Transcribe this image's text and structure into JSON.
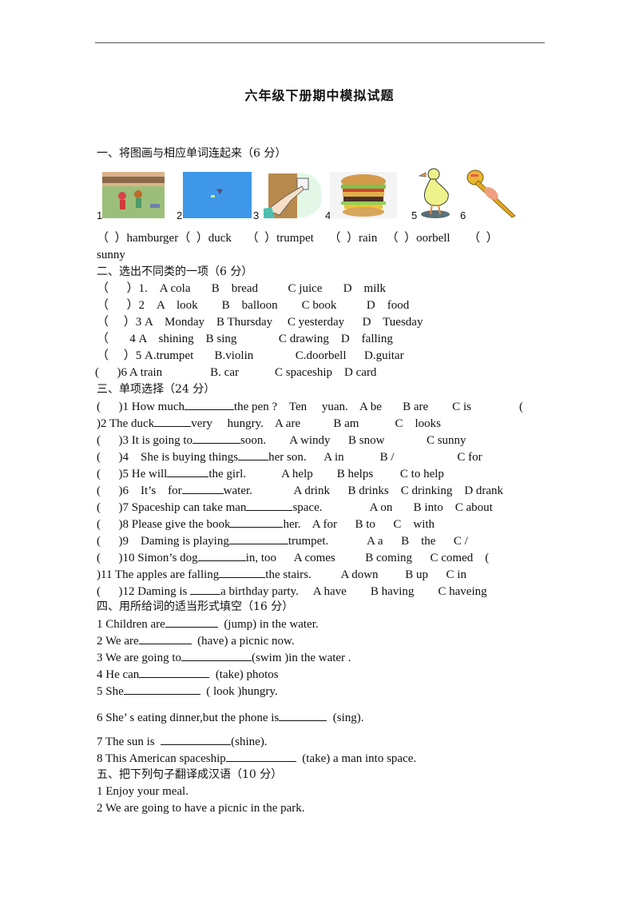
{
  "title": "六年级下册期中模拟试题",
  "sections": {
    "s1": {
      "heading": "一、将图画与相应单词连起来（6 分）",
      "pictures": [
        {
          "num": "1",
          "icon": "children-painting-image"
        },
        {
          "num": "2",
          "icon": "kite-sky-image"
        },
        {
          "num": "3",
          "icon": "doorbell-finger-image"
        },
        {
          "num": "4",
          "icon": "hamburger-image"
        },
        {
          "num": "5",
          "icon": "duck-image"
        },
        {
          "num": "6",
          "icon": "trumpet-image"
        }
      ],
      "words_line": "（  ）hamburger（  ）duck     （  ）trumpet     （  ）rain   （  ）oorbell      （  ）",
      "words_line2": "sunny"
    },
    "s2": {
      "heading": "二、选出不同类的一项（6 分）",
      "items": [
        "（      ）1.    A cola       B    bread          C juice       D    milk",
        "（      ）2    A    look        B    balloon        C book          D    food",
        "（     ）3 A    Monday    B Thursday     C yesterday      D    Tuesday",
        "（       4 A    shining    B sing              C drawing    D    falling",
        "（     ）5 A.trumpet       B.violin              C.doorbell      D.guitar",
        "(      )6 A train                B. car            C spaceship    D card"
      ]
    },
    "s3": {
      "heading": "三、单项选择（24 分）",
      "items": [
        {
          "pre": "(      )1 How much",
          "blank": 62,
          "post": "the pen ?    Ten     yuan.    A be       B are        C is                ("
        },
        {
          "pre": ")2 The duck",
          "blank": 46,
          "post": "very     hungry.    A are           B am            C    looks"
        },
        {
          "pre": "(      )3 It is going to",
          "blank": 60,
          "post": "soon.        A windy      B snow              C sunny"
        },
        {
          "pre": "(      )4    She is buying things",
          "blank": 38,
          "post": "her son.      A in            B /                     C for"
        },
        {
          "pre": "(      )5 He will",
          "blank": 52,
          "post": "the girl.            A help        B helps         C to help"
        },
        {
          "pre": "(      )6    It’s    for",
          "blank": 52,
          "post": "water.              A drink      B drinks    C drinking    D drank"
        },
        {
          "pre": "(      )7 Spaceship can take man",
          "blank": 58,
          "post": "space.                A on       B into    C about"
        },
        {
          "pre": "(      )8 Please give the book",
          "blank": 66,
          "post": "her.    A for      B to      C    with"
        },
        {
          "pre": "(      )9    Daming is playing",
          "blank": 74,
          "post": "trumpet.             A a      B    the      C /"
        },
        {
          "pre": "(      )10 Simon’s dog",
          "blank": 60,
          "post": "in, too      A comes          B coming      C comed    ("
        },
        {
          "pre": ")11 The apples are falling",
          "blank": 58,
          "post": "the stairs.          A down         B up      C in"
        },
        {
          "pre": "(      )12 Daming is ",
          "blank": 38,
          "post": "a birthday party.     A have        B having        C haveing"
        }
      ]
    },
    "s4": {
      "heading": "四、用所给词的适当形式填空（16 分）",
      "items": [
        {
          "pre": "1 Children are",
          "blank": 66,
          "post": "  (jump) in the water."
        },
        {
          "pre": "2 We are",
          "blank": 66,
          "post": "  (have) a picnic now."
        },
        {
          "pre": "3 We are going to",
          "blank": 88,
          "post": "(swim )in the water ."
        },
        {
          "pre": "4 He can",
          "blank": 88,
          "post": "  (take) photos"
        },
        {
          "pre": "5 She",
          "blank": 96,
          "post": "  ( look )hungry."
        },
        {
          "pre": "6 She’ s eating dinner,but the phone is",
          "blank": 60,
          "post": "  (sing)."
        },
        {
          "pre": "7 The sun is  ",
          "blank": 88,
          "post": "(shine)."
        },
        {
          "pre": "8 This American spaceship",
          "blank": 88,
          "post": "  (take) a man into space."
        }
      ]
    },
    "s5": {
      "heading": "五、把下列句子翻译成汉语（10 分）",
      "items": [
        "1 Enjoy your meal.",
        "2 We are going to have a picnic in the park."
      ]
    }
  }
}
